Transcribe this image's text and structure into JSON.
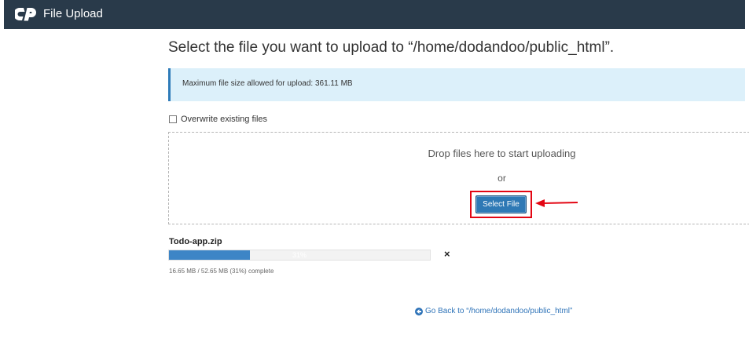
{
  "header": {
    "app_title": "File Upload",
    "logo_icon": "cpanel-logo-icon"
  },
  "main": {
    "title": "Select the file you want to upload to “/home/dodandoo/public_html”.",
    "max_size_notice": "Maximum file size allowed for upload: 361.11 MB",
    "overwrite_label": "Overwrite existing files",
    "overwrite_checked": false,
    "drop_text": "Drop files here to start uploading",
    "or_text": "or",
    "select_button_label": "Select File"
  },
  "upload": {
    "filename": "Todo-app.zip",
    "progress_percent": 31,
    "progress_label": "31%",
    "status": "16.65 MB / 52.65 MB (31%) complete",
    "cancel_label": "×"
  },
  "footer": {
    "go_back_label": "Go Back to “/home/dodandoo/public_html”",
    "go_back_icon": "arrow-left-circle-icon"
  },
  "colors": {
    "header_bg": "#293a4a",
    "accent": "#2f79b5",
    "highlight": "#e30613",
    "notice_bg": "#dcf0fa"
  }
}
